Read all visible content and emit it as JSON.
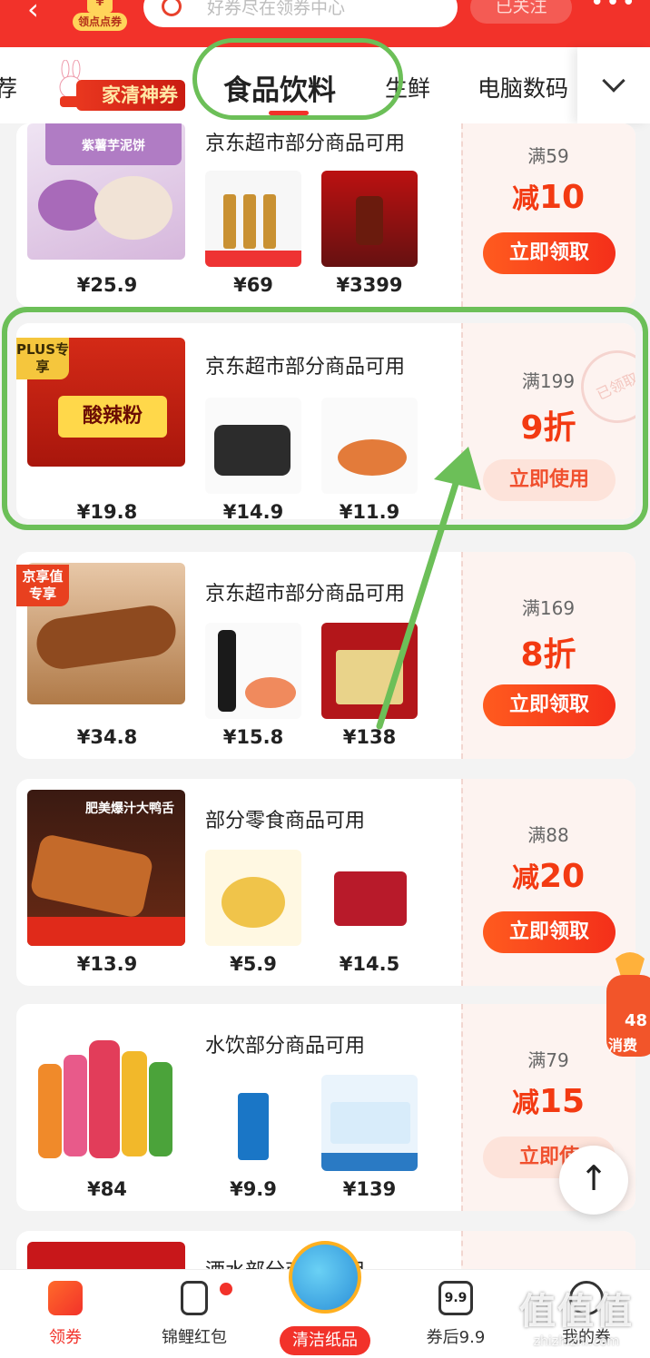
{
  "header": {
    "back_icon": "back-arrow-icon",
    "points_coin": "¥",
    "points_label": "领点点券",
    "search_placeholder": "好券尽在领券中心",
    "follow_label": "已关注",
    "more_label": "•••"
  },
  "tabs": {
    "partial_left": "荐",
    "promo_label": "家清神券",
    "items": [
      "食品饮料",
      "生鲜",
      "电脑数码"
    ],
    "more_icon": "chevron-down-icon"
  },
  "coupons": [
    {
      "title": "京东超市部分商品可用",
      "prices": [
        "¥25.9",
        "¥69",
        "¥3399"
      ],
      "threshold": "满59",
      "discount_prefix": "减",
      "discount_value": "10",
      "action": "立即领取",
      "main_img_text": "紫薯芋泥饼"
    },
    {
      "badge": "PLUS专享",
      "title": "京东超市部分商品可用",
      "prices": [
        "¥19.8",
        "¥14.9",
        "¥11.9"
      ],
      "threshold": "满199",
      "discount_prefix": "",
      "discount_value": "9折",
      "action": "立即使用",
      "stamp": "已领取",
      "main_img_text": "酸辣粉"
    },
    {
      "badge": "京享值专享",
      "title": "京东超市部分商品可用",
      "prices": [
        "¥34.8",
        "¥15.8",
        "¥138"
      ],
      "threshold": "满169",
      "discount_prefix": "",
      "discount_value": "8折",
      "action": "立即领取"
    },
    {
      "title": "部分零食商品可用",
      "prices": [
        "¥13.9",
        "¥5.9",
        "¥14.5"
      ],
      "threshold": "满88",
      "discount_prefix": "减",
      "discount_value": "20",
      "action": "立即领取",
      "main_img_text": "肥美爆汁大鸭舌"
    },
    {
      "title": "水饮部分商品可用",
      "prices": [
        "¥84",
        "¥9.9",
        "¥139"
      ],
      "threshold": "满79",
      "discount_prefix": "减",
      "discount_value": "15",
      "action": "立即使"
    },
    {
      "title": "酒水部分商品可用"
    }
  ],
  "bottom_nav": {
    "items": [
      "领券",
      "锦鲤红包",
      "清洁纸品",
      "券后9.9",
      "我的券"
    ],
    "icon_99": "9.9"
  },
  "float": {
    "gift_number": "48",
    "gift_label": "消费",
    "to_top_icon": "↑"
  },
  "watermark": {
    "big": "值值值",
    "small": "zhizhizhi.com"
  },
  "colors": {
    "brand_red": "#f2322a",
    "discount_orange": "#f33a12",
    "annotation_green": "#6cbf58"
  }
}
